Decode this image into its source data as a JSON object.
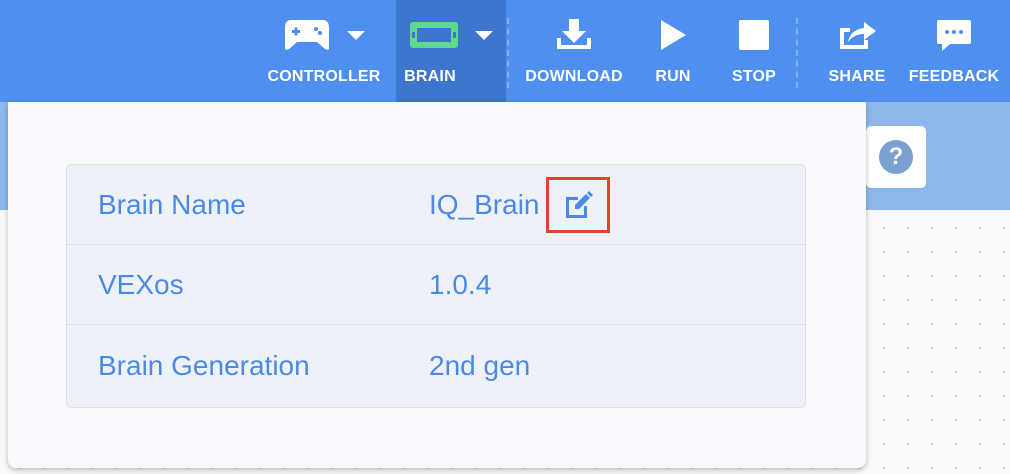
{
  "toolbar": {
    "items": [
      {
        "label": "CONTROLLER",
        "icon": "gamepad-icon"
      },
      {
        "label": "BRAIN",
        "icon": "brain-icon"
      },
      {
        "label": "DOWNLOAD",
        "icon": "download-icon"
      },
      {
        "label": "RUN",
        "icon": "play-icon"
      },
      {
        "label": "STOP",
        "icon": "stop-icon"
      },
      {
        "label": "SHARE",
        "icon": "share-icon"
      },
      {
        "label": "FEEDBACK",
        "icon": "feedback-icon"
      }
    ]
  },
  "help": {
    "glyph": "?"
  },
  "brain_info": {
    "rows": [
      {
        "key": "Brain Name",
        "value": "IQ_Brain"
      },
      {
        "key": "VEXos",
        "value": "1.0.4"
      },
      {
        "key": "Brain Generation",
        "value": "2nd gen"
      }
    ]
  },
  "colors": {
    "toolbar": "#4e8ff0",
    "active_tab": "#3d76cc",
    "text_accent": "#4a8ae6",
    "highlight": "#e0432e",
    "brain_screen": "#5fd98a"
  }
}
